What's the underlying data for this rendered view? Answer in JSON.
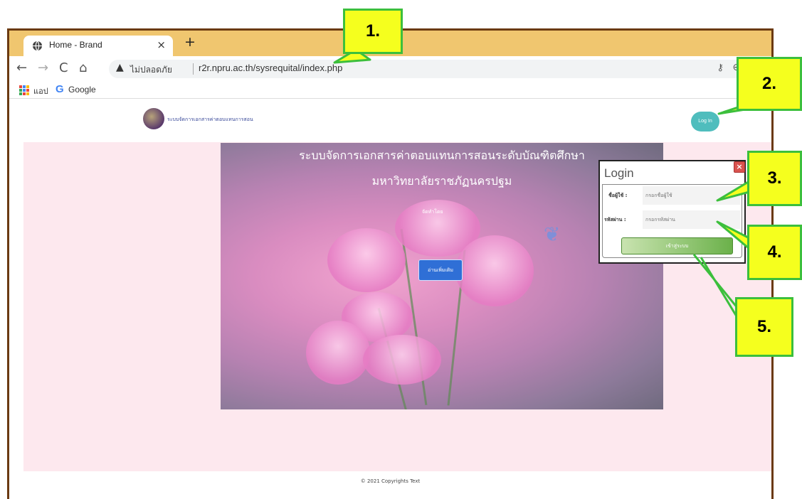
{
  "browser": {
    "tab_title": "Home - Brand",
    "tab_close": "×",
    "new_tab": "+",
    "nav": {
      "back": "←",
      "forward": "→",
      "reload": "C",
      "home": "⌂"
    },
    "security_label": "ไม่ปลอดภัย",
    "url": "r2r.npru.ac.th/sysrequital/index.php",
    "bookmarks": {
      "apps_label": "แอป",
      "google_logo": "G",
      "google_label": "Google"
    }
  },
  "site": {
    "brand_text": "ระบบจัดการเอกสารค่าตอบแทนการสอน",
    "login_button": "Log In",
    "hero": {
      "title_line1": "ระบบจัดการเอกสารค่าตอบแทนการสอนระดับบัณฑิตศึกษา",
      "title_line2": "มหาวิทยาลัยราชภัฏนครปฐม",
      "subtitle": "จัดทำโดย",
      "read_more": "อ่านเพิ่มเติม"
    },
    "footer": "© 2021 Copyrights Text"
  },
  "login_modal": {
    "title": "Login",
    "close": "×",
    "username_label": "ชื่อผู้ใช้ :",
    "username_placeholder": "กรอกชื่อผู้ใช้",
    "password_label": "รหัสผ่าน :",
    "password_placeholder": "กรอกรหัสผ่าน",
    "submit": "เข้าสู่ระบบ"
  },
  "callouts": [
    "1.",
    "2.",
    "3.",
    "4.",
    "5."
  ],
  "colors": {
    "tabbar": "#f0c66f",
    "frame_border": "#6b3a12",
    "login_button": "#4fbdbd",
    "callout_fill": "#f5ff1e",
    "callout_border": "#3cbf3c",
    "hero_bg": "#fde8ee"
  }
}
